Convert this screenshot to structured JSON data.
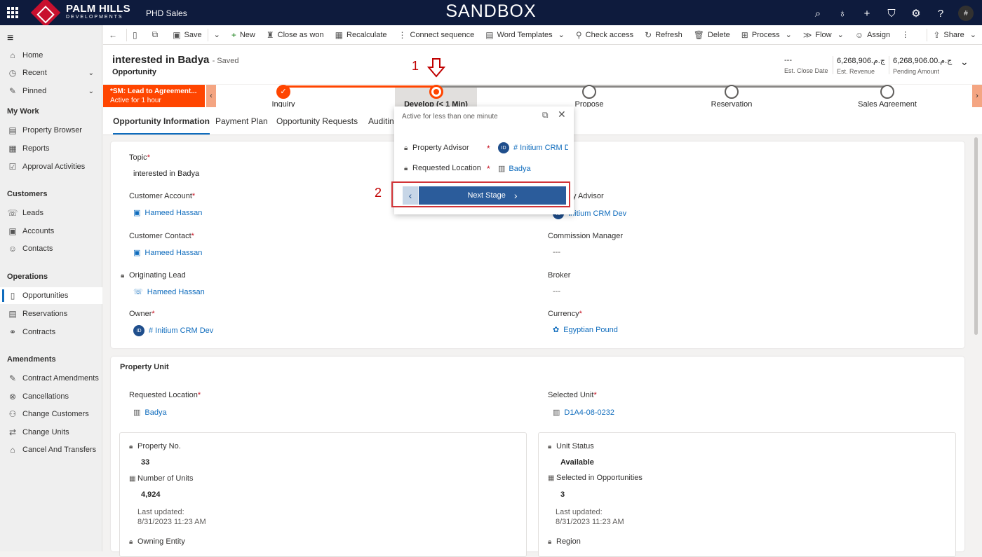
{
  "topbar": {
    "brand_line1": "PALM HILLS",
    "brand_line2": "DEVELOPMENTS",
    "app_name": "PHD Sales",
    "environment": "SANDBOX",
    "icons": [
      "search-icon",
      "lightbulb-icon",
      "plus-icon",
      "filter-icon",
      "settings-icon",
      "help-icon",
      "user-avatar"
    ],
    "avatar_text": "#"
  },
  "sidebar": {
    "top_items": [
      {
        "label": "Home",
        "icon": "home-icon"
      },
      {
        "label": "Recent",
        "icon": "clock-icon"
      },
      {
        "label": "Pinned",
        "icon": "pin-icon"
      }
    ],
    "groups": [
      {
        "heading": "My Work",
        "items": [
          "Property Browser",
          "Reports",
          "Approval Activities"
        ]
      },
      {
        "heading": "Customers",
        "items": [
          "Leads",
          "Accounts",
          "Contacts"
        ]
      },
      {
        "heading": "Operations",
        "items": [
          "Opportunities",
          "Reservations",
          "Contracts"
        ]
      },
      {
        "heading": "Amendments",
        "items": [
          "Contract Amendments",
          "Cancellations",
          "Change Customers",
          "Change Units",
          "Cancel And Transfers"
        ]
      }
    ],
    "active_item": "Opportunities"
  },
  "commandbar": {
    "items": [
      "Save",
      "New",
      "Close as won",
      "Recalculate",
      "Connect sequence",
      "Word Templates",
      "Check access",
      "Refresh",
      "Delete",
      "Process",
      "Flow",
      "Assign",
      "Share"
    ]
  },
  "header": {
    "title": "interested in Badya",
    "saved": "- Saved",
    "entity": "Opportunity",
    "fields": [
      {
        "value": "---",
        "label": "Est. Close Date"
      },
      {
        "value": "6,268,906.ج.م",
        "label": "Est. Revenue"
      },
      {
        "value": "6,268,906.00.ج.م",
        "label": "Pending Amount"
      }
    ]
  },
  "bpf": {
    "active_process": "*SM: Lead to Agreement...",
    "active_duration": "Active for 1 hour",
    "stages": [
      {
        "label": "Inquiry",
        "state": "done"
      },
      {
        "label": "Develop  (< 1 Min)",
        "state": "current"
      },
      {
        "label": "Propose",
        "state": "pending"
      },
      {
        "label": "Reservation",
        "state": "pending"
      },
      {
        "label": "Sales Agreement",
        "state": "pending"
      }
    ]
  },
  "tabs": [
    "Opportunity Information",
    "Payment Plan",
    "Opportunity Requests",
    "Auditin"
  ],
  "flyout": {
    "status": "Active for less than one minute",
    "fields": [
      {
        "label": "Property Advisor",
        "value": "# Initium CRM D"
      },
      {
        "label": "Requested Location",
        "value": "Badya"
      }
    ],
    "next_button": "Next Stage"
  },
  "annotations": {
    "one": "1",
    "two": "2"
  },
  "info_section": {
    "topic_label": "Topic",
    "topic_value": "interested in Badya",
    "customer_account_label": "Customer Account",
    "customer_account_value": "Hameed Hassan",
    "customer_contact_label": "Customer Contact",
    "customer_contact_value": "Hameed Hassan",
    "originating_lead_label": "Originating Lead",
    "originating_lead_value": "Hameed Hassan",
    "owner_label": "Owner",
    "owner_value": "# Initium CRM Dev",
    "advisor_label": "y Advisor",
    "advisor_value": "Initium CRM Dev",
    "commission_label": "Commission Manager",
    "commission_value": "---",
    "broker_label": "Broker",
    "broker_value": "---",
    "currency_label": "Currency",
    "currency_value": "Egyptian Pound",
    "avatar_initials": "ID"
  },
  "property_unit": {
    "section_title": "Property Unit",
    "requested_location_label": "Requested Location",
    "requested_location_value": "Badya",
    "selected_unit_label": "Selected Unit",
    "selected_unit_value": "D1A4-08-0232",
    "property_no_label": "Property No.",
    "property_no_value": "33",
    "number_units_label": "Number of Units",
    "number_units_value": "4,924",
    "last_updated_label": "Last updated:",
    "last_updated_value": "8/31/2023 11:23 AM",
    "owning_entity_label": "Owning Entity",
    "unit_status_label": "Unit Status",
    "unit_status_value": "Available",
    "selected_in_opps_label": "Selected in Opportunities",
    "selected_in_opps_value": "3",
    "last_updated2_label": "Last updated:",
    "last_updated2_value": "8/31/2023 11:23 AM",
    "region_label": "Region"
  }
}
